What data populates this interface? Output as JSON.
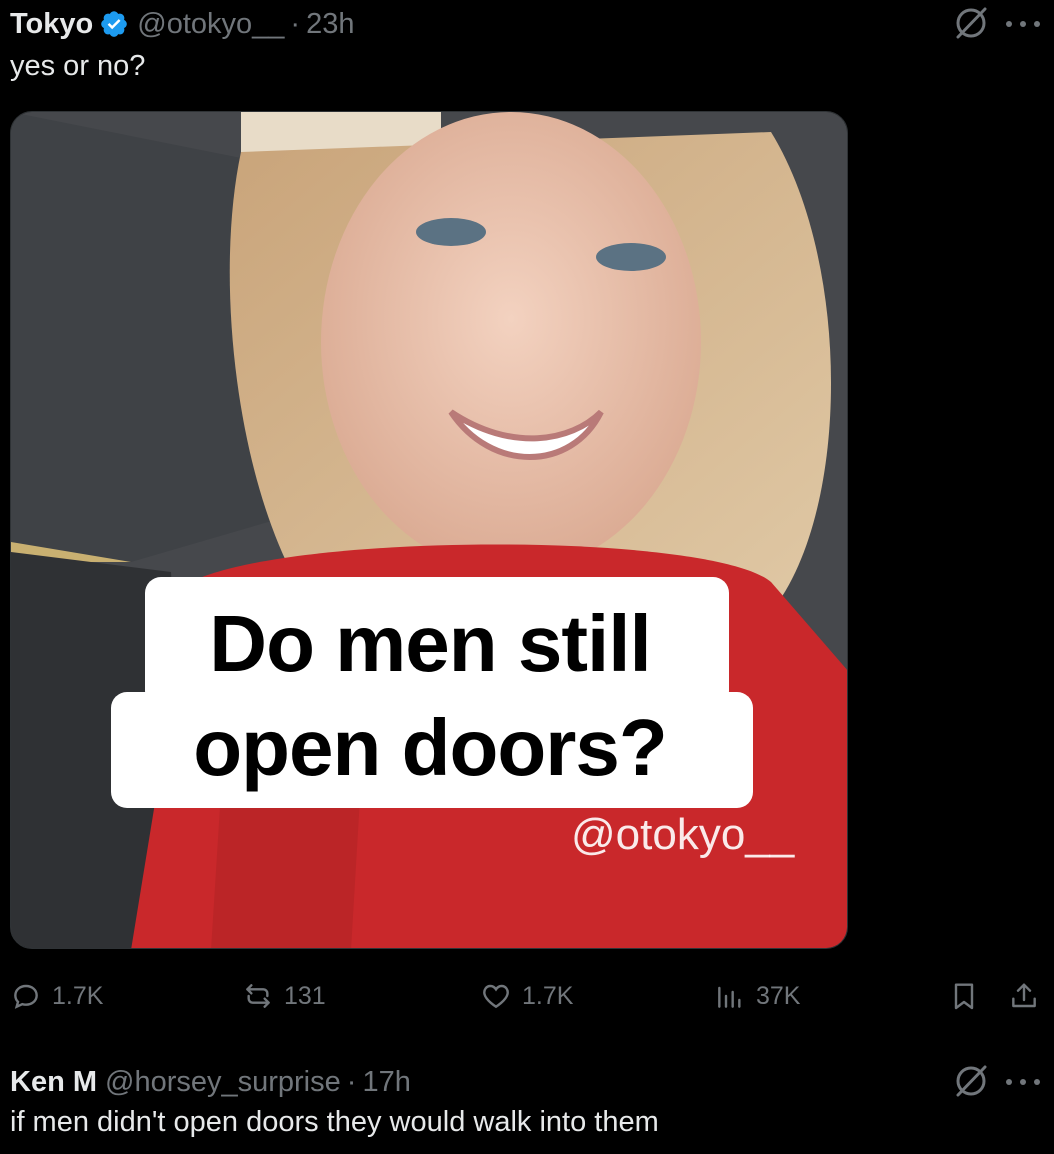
{
  "tweet": {
    "name": "Tokyo",
    "handle": "@otokyo__",
    "separator": "·",
    "time": "23h",
    "text": "yes or no?",
    "image": {
      "caption_line1": "Do men still",
      "caption_line2": "open doors?",
      "watermark": "@otokyo__"
    },
    "actions": {
      "replies": "1.7K",
      "reposts": "131",
      "likes": "1.7K",
      "views": "37K"
    }
  },
  "reply": {
    "name": "Ken M",
    "handle": "@horsey_surprise",
    "separator": "·",
    "time": "17h",
    "text": "if men didn't open doors they would walk into them"
  },
  "colors": {
    "background": "#000000",
    "text_primary": "#e7e9ea",
    "text_secondary": "#71767b",
    "verified": "#1d9bf0"
  },
  "icons": [
    "verified-badge-icon",
    "grok-icon",
    "more-icon",
    "reply-icon",
    "repost-icon",
    "like-icon",
    "views-icon",
    "bookmark-icon",
    "share-icon"
  ]
}
